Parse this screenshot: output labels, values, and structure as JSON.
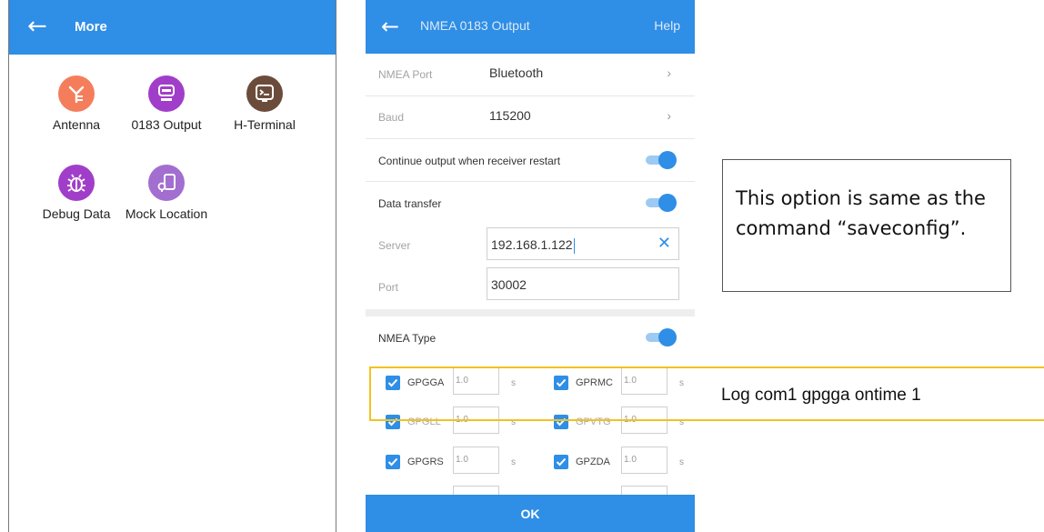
{
  "left": {
    "title": "More",
    "items": [
      {
        "label": "Antenna",
        "icon": "antenna-icon",
        "color": "#f47e5b"
      },
      {
        "label": "0183 Output",
        "icon": "nmea-icon",
        "color": "#a13ec9"
      },
      {
        "label": "H-Terminal",
        "icon": "terminal-icon",
        "color": "#6b4c3b"
      },
      {
        "label": "Debug Data",
        "icon": "bug-icon",
        "color": "#a13ec9"
      },
      {
        "label": "Mock Location",
        "icon": "mock-location-icon",
        "color": "#a26ed0"
      }
    ]
  },
  "nmea": {
    "title": "NMEA 0183 Output",
    "help": "Help",
    "port_label": "NMEA Port",
    "port_value": "Bluetooth",
    "baud_label": "Baud",
    "baud_value": "115200",
    "continue_label": "Continue output when receiver restart",
    "continue_on": true,
    "data_transfer_label": "Data transfer",
    "data_transfer_on": true,
    "server_label": "Server",
    "server_value": "192.168.1.122",
    "port2_label": "Port",
    "port2_value": "30002",
    "type_label": "NMEA Type",
    "type_on": true,
    "messages": [
      {
        "name": "GPGGA",
        "interval": "1.0",
        "unit": "s",
        "checked": true
      },
      {
        "name": "GPRMC",
        "interval": "1.0",
        "unit": "s",
        "checked": true
      },
      {
        "name": "GPGLL",
        "interval": "1.0",
        "unit": "s",
        "checked": true
      },
      {
        "name": "GPVTG",
        "interval": "1.0",
        "unit": "s",
        "checked": true
      },
      {
        "name": "GPGRS",
        "interval": "1.0",
        "unit": "s",
        "checked": true
      },
      {
        "name": "GPZDA",
        "interval": "1.0",
        "unit": "s",
        "checked": true
      }
    ],
    "ok_label": "OK",
    "accent": "#2f8ee6"
  },
  "annotations": {
    "callout": "This option is same as the command “saveconfig”.",
    "log_cmd": "Log com1 gpgga ontime 1",
    "highlight_color": "#f2c21f"
  }
}
